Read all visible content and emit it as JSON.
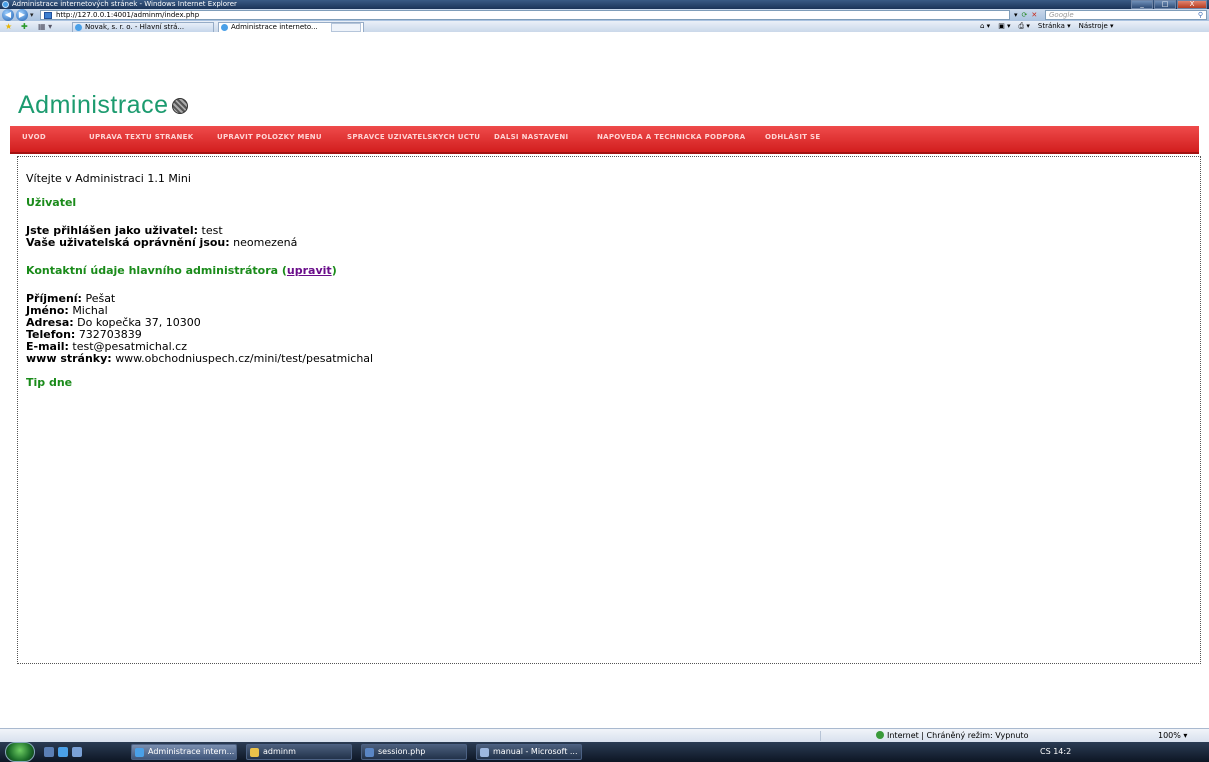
{
  "window": {
    "title": "Administrace internetových stránek - Windows Internet Explorer",
    "min": "_",
    "max": "□",
    "close": "X"
  },
  "browser": {
    "url": "http://127.0.0.1:4001/adminm/index.php",
    "search_placeholder": "Google",
    "tabs": [
      {
        "label": "Novak, s. r. o. - Hlavní strá..."
      },
      {
        "label": "Administrace interneto...",
        "close": "X"
      }
    ],
    "commands": {
      "home": "⌂ ▾",
      "feeds": "▣ ▾",
      "print": "⎙ ▾",
      "page": "Stránka ▾",
      "tools": "Nástroje ▾"
    }
  },
  "page": {
    "logo": "Administrace",
    "menu": [
      "UVOD",
      "UPRAVA TEXTU STRANEK",
      "UPRAVIT POLOZKY MENU",
      "SPRAVCE UZIVATELSKYCH UCTU",
      "DALSI NASTAVENI",
      "NAPOVEDA A TECHNICKA PODPORA",
      "ODHLÁSIT SE"
    ],
    "welcome": "Vítejte v Administraci 1.1 Mini",
    "user_heading": "Uživatel",
    "logged_label": "Jste přihlášen jako uživatel:",
    "logged_value": "test",
    "perm_label": "Vaše uživatelská oprávnění jsou:",
    "perm_value": "neomezená",
    "contact_heading": "Kontaktní údaje hlavního administrátora",
    "contact_link": "upravit",
    "contact": [
      {
        "label": "Příjmení:",
        "value": "Pešat"
      },
      {
        "label": "Jméno:",
        "value": "Michal"
      },
      {
        "label": "Adresa:",
        "value": "Do kopečka 37, 10300"
      },
      {
        "label": "Telefon:",
        "value": "732703839"
      },
      {
        "label": "E-mail:",
        "value": "test@pesatmichal.cz"
      },
      {
        "label": "www stránky:",
        "value": "www.obchodniuspech.cz/mini/test/pesatmichal"
      }
    ],
    "tip_heading": "Tip dne"
  },
  "status": {
    "zone": "Internet | Chráněný režim: Vypnuto",
    "zoom": "100% ▾"
  },
  "taskbar": {
    "items": [
      "Administrace intern...",
      "adminm",
      "session.php",
      "manual - Microsoft ..."
    ],
    "tray": "CS   14:2"
  }
}
